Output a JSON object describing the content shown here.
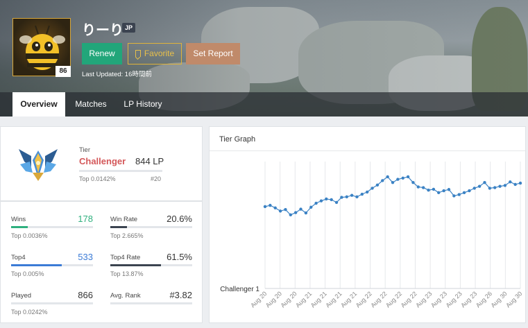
{
  "profile": {
    "name": "りーり",
    "region": "JP",
    "level": "86",
    "last_updated": "Last Updated: 16時間前"
  },
  "buttons": {
    "renew": "Renew",
    "favorite": "Favorite",
    "report": "Set Report"
  },
  "tabs": [
    {
      "label": "Overview",
      "active": true
    },
    {
      "label": "Matches",
      "active": false
    },
    {
      "label": "LP History",
      "active": false
    }
  ],
  "rank": {
    "tier_label": "Tier",
    "tier": "Challenger",
    "lp": "844 LP",
    "top": "Top 0.0142%",
    "position": "#20"
  },
  "stats": [
    {
      "label": "Wins",
      "value": "178",
      "sub": "Top 0.0036%",
      "fill": 0.2,
      "color": "#2fb07e",
      "value_color": "#2fb07e"
    },
    {
      "label": "Win Rate",
      "value": "20.6%",
      "sub": "Top 2.665%",
      "fill": 0.206,
      "color": "#3b4350",
      "value_color": "#333333"
    },
    {
      "label": "Top4",
      "value": "533",
      "sub": "Top 0.005%",
      "fill": 0.615,
      "color": "#3b7bd6",
      "value_color": "#3b7bd6"
    },
    {
      "label": "Top4 Rate",
      "value": "61.5%",
      "sub": "Top 13.87%",
      "fill": 0.615,
      "color": "#3b4350",
      "value_color": "#333333"
    },
    {
      "label": "Played",
      "value": "866",
      "sub": "Top 0.0242%",
      "fill": 0,
      "color": "#3b4350",
      "value_color": "#333333"
    },
    {
      "label": "Avg. Rank",
      "value": "#3.82",
      "sub": "",
      "fill": 0,
      "color": "#3b4350",
      "value_color": "#333333"
    }
  ],
  "graph": {
    "title": "Tier Graph"
  },
  "chart_data": {
    "type": "line",
    "ylabel_tick": "Challenger 1",
    "x_labels": [
      "Aug 20",
      "Aug 20",
      "Aug 20",
      "Aug 21",
      "Aug 21",
      "Aug 21",
      "Aug 21",
      "Aug 22",
      "Aug 22",
      "Aug 22",
      "Aug 22",
      "Aug 23",
      "Aug 23",
      "Aug 23",
      "Aug 23",
      "Aug 26",
      "Aug 30",
      "Aug 30"
    ],
    "values": [
      645,
      655,
      635,
      610,
      622,
      580,
      598,
      625,
      595,
      640,
      672,
      690,
      705,
      700,
      678,
      718,
      722,
      734,
      722,
      743,
      760,
      790,
      815,
      850,
      880,
      835,
      860,
      870,
      880,
      835,
      800,
      795,
      775,
      782,
      755,
      770,
      780,
      730,
      740,
      755,
      770,
      790,
      805,
      835,
      790,
      795,
      805,
      812,
      840,
      820,
      830
    ],
    "y_base": 0,
    "color": "#3b82c4"
  }
}
